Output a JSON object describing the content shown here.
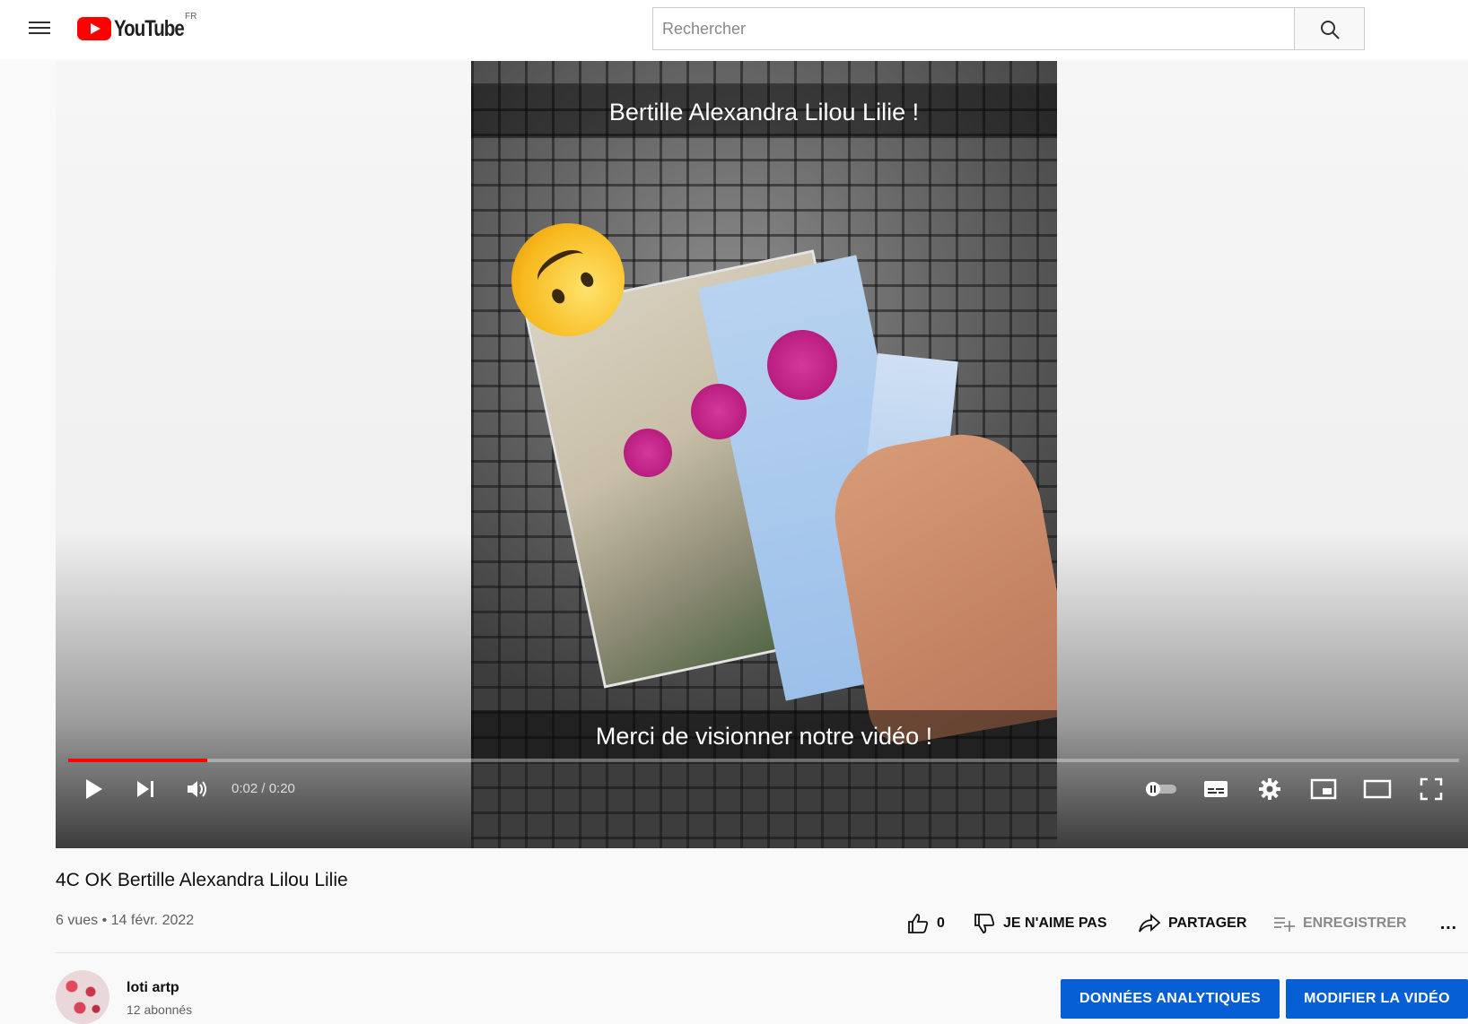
{
  "header": {
    "logo_text": "YouTube",
    "region": "FR",
    "search": {
      "placeholder": "Rechercher",
      "value": ""
    }
  },
  "player": {
    "overlay_top": "Bertille Alexandra Lilou Lilie !",
    "overlay_bottom": "Merci de visionner notre vidéo !",
    "time": "0:02 / 0:20",
    "progress_fraction": 0.1,
    "progress_color": "#ff0000"
  },
  "video": {
    "title": "4C OK Bertille Alexandra Lilou Lilie",
    "views": "6 vues",
    "date": "14 févr. 2022",
    "actions": {
      "like_count": "0",
      "dislike": "JE N'AIME PAS",
      "share": "PARTAGER",
      "save": "ENREGISTRER",
      "more": "…"
    }
  },
  "channel": {
    "name": "loti artp",
    "subscribers": "12 abonnés",
    "analytics_button": "DONNÉES ANALYTIQUES",
    "edit_button": "MODIFIER LA VIDÉO",
    "button_color": "#065fd4"
  },
  "icons": [
    "menu-icon",
    "youtube-logo-icon",
    "search-icon",
    "play-icon",
    "next-icon",
    "volume-icon",
    "autoplay-toggle-icon",
    "subtitles-icon",
    "settings-icon",
    "miniplayer-icon",
    "theater-icon",
    "fullscreen-icon",
    "like-icon",
    "dislike-icon",
    "share-icon",
    "save-icon",
    "more-icon"
  ]
}
